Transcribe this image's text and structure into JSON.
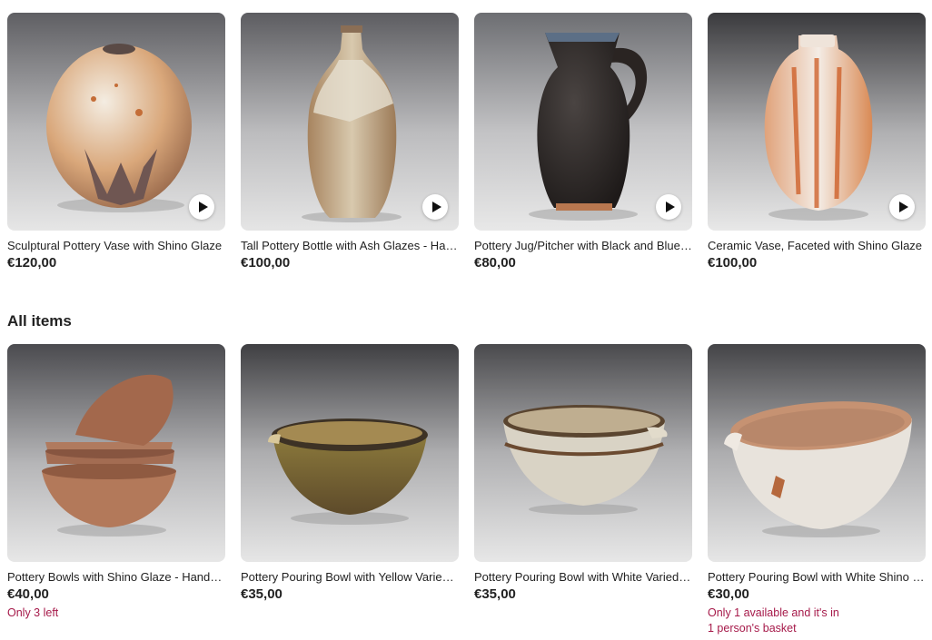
{
  "featured": [
    {
      "title": "Sculptural Pottery Vase with Shino Glaze",
      "price": "€120,00",
      "icon": "play-video-icon"
    },
    {
      "title": "Tall Pottery Bottle with Ash Glazes - Handmade",
      "price": "€100,00",
      "icon": "play-video-icon"
    },
    {
      "title": "Pottery Jug/Pitcher with Black and Blue Glaze",
      "price": "€80,00",
      "icon": "play-video-icon"
    },
    {
      "title": "Ceramic Vase, Faceted with Shino Glaze",
      "price": "€100,00",
      "icon": "play-video-icon"
    }
  ],
  "all_items": {
    "heading": "All items",
    "items": [
      {
        "title": "Pottery Bowls with Shino Glaze - Handmade",
        "price": "€40,00",
        "note_lines": [
          "Only 3 left"
        ]
      },
      {
        "title": "Pottery Pouring Bowl with Yellow Varied Glaze",
        "price": "€35,00",
        "note_lines": []
      },
      {
        "title": "Pottery Pouring Bowl with White Varied Glaze",
        "price": "€35,00",
        "note_lines": []
      },
      {
        "title": "Pottery Pouring Bowl with White Shino Glaze",
        "price": "€30,00",
        "note_lines": [
          "Only 1 available and it's in",
          "1 person's basket"
        ]
      }
    ]
  },
  "colors": {
    "text": "#222222",
    "scarcity": "#a61a4a",
    "background": "#ffffff"
  }
}
